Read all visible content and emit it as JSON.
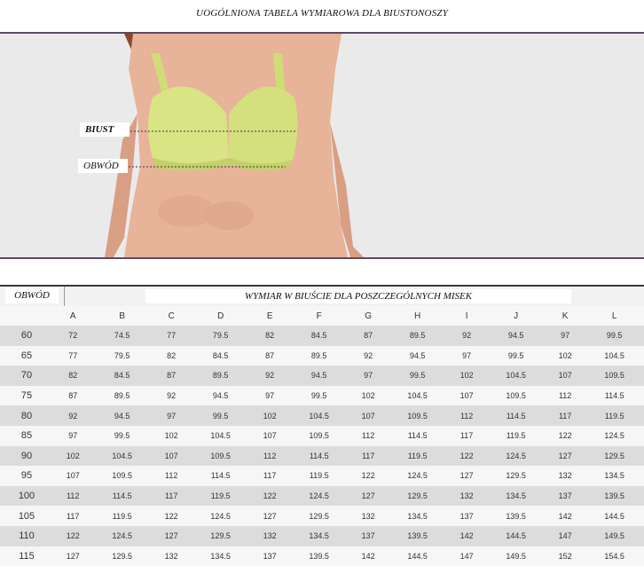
{
  "title": "UOGÓLNIONA TABELA WYMIAROWA DLA BIUSTONOSZY",
  "photo_labels": {
    "bust": "BIUST",
    "band": "OBWÓD"
  },
  "table": {
    "band_header": "OBWÓD",
    "cup_header": "WYMIAR W BIUŚCIE DLA POSZCZEGÓLNYCH MISEK",
    "cups": [
      "A",
      "B",
      "C",
      "D",
      "E",
      "F",
      "G",
      "H",
      "I",
      "J",
      "K",
      "L"
    ],
    "rows": [
      {
        "band": "60",
        "values": [
          "72",
          "74.5",
          "77",
          "79.5",
          "82",
          "84.5",
          "87",
          "89.5",
          "92",
          "94.5",
          "97",
          "99.5"
        ]
      },
      {
        "band": "65",
        "values": [
          "77",
          "79.5",
          "82",
          "84.5",
          "87",
          "89.5",
          "92",
          "94.5",
          "97",
          "99.5",
          "102",
          "104.5"
        ]
      },
      {
        "band": "70",
        "values": [
          "82",
          "84.5",
          "87",
          "89.5",
          "92",
          "94.5",
          "97",
          "99.5",
          "102",
          "104.5",
          "107",
          "109.5"
        ]
      },
      {
        "band": "75",
        "values": [
          "87",
          "89.5",
          "92",
          "94.5",
          "97",
          "99.5",
          "102",
          "104.5",
          "107",
          "109.5",
          "112",
          "114.5"
        ]
      },
      {
        "band": "80",
        "values": [
          "92",
          "94.5",
          "97",
          "99.5",
          "102",
          "104.5",
          "107",
          "109.5",
          "112",
          "114.5",
          "117",
          "119.5"
        ]
      },
      {
        "band": "85",
        "values": [
          "97",
          "99.5",
          "102",
          "104.5",
          "107",
          "109.5",
          "112",
          "114.5",
          "117",
          "119.5",
          "122",
          "124.5"
        ]
      },
      {
        "band": "90",
        "values": [
          "102",
          "104.5",
          "107",
          "109.5",
          "112",
          "114.5",
          "117",
          "119.5",
          "122",
          "124.5",
          "127",
          "129.5"
        ]
      },
      {
        "band": "95",
        "values": [
          "107",
          "109.5",
          "112",
          "114.5",
          "117",
          "119.5",
          "122",
          "124.5",
          "127",
          "129.5",
          "132",
          "134.5"
        ]
      },
      {
        "band": "100",
        "values": [
          "112",
          "114.5",
          "117",
          "119.5",
          "122",
          "124.5",
          "127",
          "129.5",
          "132",
          "134.5",
          "137",
          "139.5"
        ]
      },
      {
        "band": "105",
        "values": [
          "117",
          "119.5",
          "122",
          "124.5",
          "127",
          "129.5",
          "132",
          "134.5",
          "137",
          "139.5",
          "142",
          "144.5"
        ]
      },
      {
        "band": "110",
        "values": [
          "122",
          "124.5",
          "127",
          "129.5",
          "132",
          "134.5",
          "137",
          "139.5",
          "142",
          "144.5",
          "147",
          "149.5"
        ]
      },
      {
        "band": "115",
        "values": [
          "127",
          "129.5",
          "132",
          "134.5",
          "137",
          "139.5",
          "142",
          "144.5",
          "147",
          "149.5",
          "152",
          "154.5"
        ]
      }
    ]
  },
  "colors": {
    "bra": "#d9e584",
    "divider": "#5c4a63"
  }
}
